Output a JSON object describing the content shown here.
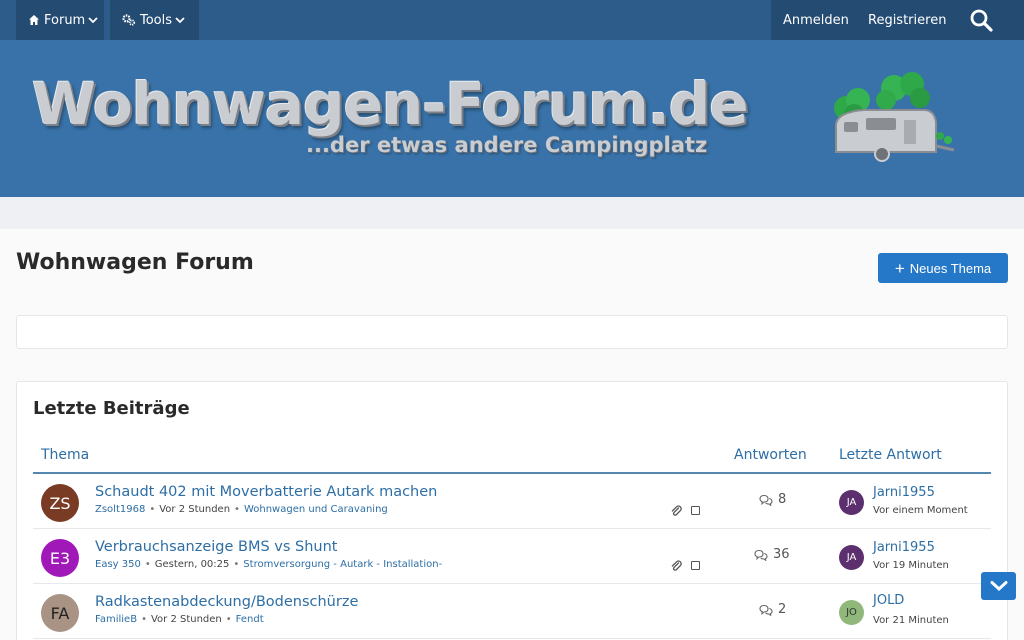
{
  "nav": {
    "forum_label": "Forum",
    "tools_label": "Tools",
    "login_label": "Anmelden",
    "register_label": "Registrieren"
  },
  "banner": {
    "logo_text": "Wohnwagen-Forum.de",
    "tagline": "...der etwas andere Campingplatz"
  },
  "page": {
    "title": "Wohnwagen Forum",
    "new_topic_label": "Neues Thema"
  },
  "latest": {
    "title": "Letzte Beiträge",
    "columns": {
      "topic": "Thema",
      "replies": "Antworten",
      "last_reply": "Letzte Antwort"
    },
    "rows": [
      {
        "avatar": "ZS",
        "avatar_color": "#7a3b24",
        "title": "Schaudt 402 mit Moverbatterie Autark machen",
        "author": "Zsolt1968",
        "time": "Vor 2 Stunden",
        "forum": "Wohnwagen und Caravaning",
        "has_attachment": true,
        "replies": "8",
        "last_avatar": "JA",
        "last_avatar_color": "#5c2f6e",
        "last_user": "Jarni1955",
        "last_time": "Vor einem Moment"
      },
      {
        "avatar": "E3",
        "avatar_color": "#a118b8",
        "title": "Verbrauchsanzeige BMS vs Shunt",
        "author": "Easy 350",
        "time": "Gestern, 00:25",
        "forum": "Stromversorgung - Autark - Installation-",
        "has_attachment": true,
        "replies": "36",
        "last_avatar": "JA",
        "last_avatar_color": "#5c2f6e",
        "last_user": "Jarni1955",
        "last_time": "Vor 19 Minuten"
      },
      {
        "avatar": "FA",
        "avatar_color": "#a89384",
        "title": "Radkastenabdeckung/Bodenschürze",
        "author": "FamilieB",
        "time": "Vor 2 Stunden",
        "forum": "Fendt",
        "has_attachment": false,
        "replies": "2",
        "last_avatar": "JO",
        "last_avatar_color": "#8fb87a",
        "last_user": "JOLD",
        "last_time": "Vor 21 Minuten"
      }
    ]
  },
  "colors": {
    "nav_bg": "#2d5b8a",
    "banner_bg": "#3872a8",
    "accent": "#2577c8",
    "link": "#2d6ea5"
  }
}
